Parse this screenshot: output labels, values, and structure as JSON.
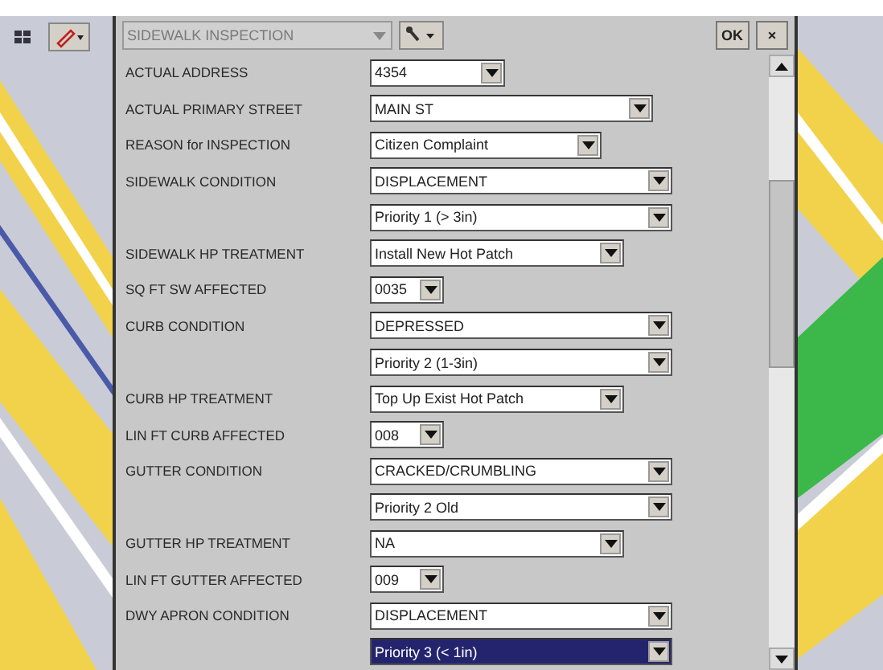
{
  "toolbar": {
    "form_name": "SIDEWALK INSPECTION",
    "form_disabled": true,
    "ok": "OK",
    "close": "×"
  },
  "fields": [
    {
      "label": "ACTUAL ADDRESS",
      "value": "4354",
      "kind": "short",
      "selected": false
    },
    {
      "label": "ACTUAL PRIMARY STREET",
      "value": "MAIN ST",
      "kind": "long",
      "selected": false
    },
    {
      "label": "REASON for INSPECTION",
      "value": "Citizen Complaint",
      "kind": "medium",
      "selected": false
    },
    {
      "label": "SIDEWALK CONDITION",
      "value": "DISPLACEMENT",
      "kind": "full",
      "selected": false
    },
    {
      "value": "Priority 1 (> 3in)",
      "kind": "full",
      "selected": false
    },
    {
      "label": "SIDEWALK HP TREATMENT",
      "value": "Install New Hot Patch",
      "kind": "wide",
      "selected": false
    },
    {
      "label": "SQ FT SW AFFECTED",
      "value": "0035",
      "kind": "tiny",
      "selected": false
    },
    {
      "label": "CURB CONDITION",
      "value": "DEPRESSED",
      "kind": "full",
      "selected": false
    },
    {
      "value": "Priority 2 (1-3in)",
      "kind": "full",
      "selected": false
    },
    {
      "label": "CURB HP TREATMENT",
      "value": "Top Up Exist Hot Patch",
      "kind": "wide",
      "selected": false
    },
    {
      "label": "LIN FT CURB AFFECTED",
      "value": "008",
      "kind": "tiny",
      "selected": false
    },
    {
      "label": "GUTTER CONDITION",
      "value": "CRACKED/CRUMBLING",
      "kind": "full",
      "selected": false
    },
    {
      "value": "Priority 2 Old",
      "kind": "full",
      "selected": false
    },
    {
      "label": "GUTTER HP TREATMENT",
      "value": "NA",
      "kind": "wide",
      "selected": false
    },
    {
      "label": "LIN FT GUTTER AFFECTED",
      "value": "009",
      "kind": "tiny",
      "selected": false
    },
    {
      "label": "DWY APRON CONDITION",
      "value": "DISPLACEMENT",
      "kind": "full",
      "selected": false
    },
    {
      "value": "Priority 3 (< 1in)",
      "kind": "full",
      "selected": true
    }
  ]
}
